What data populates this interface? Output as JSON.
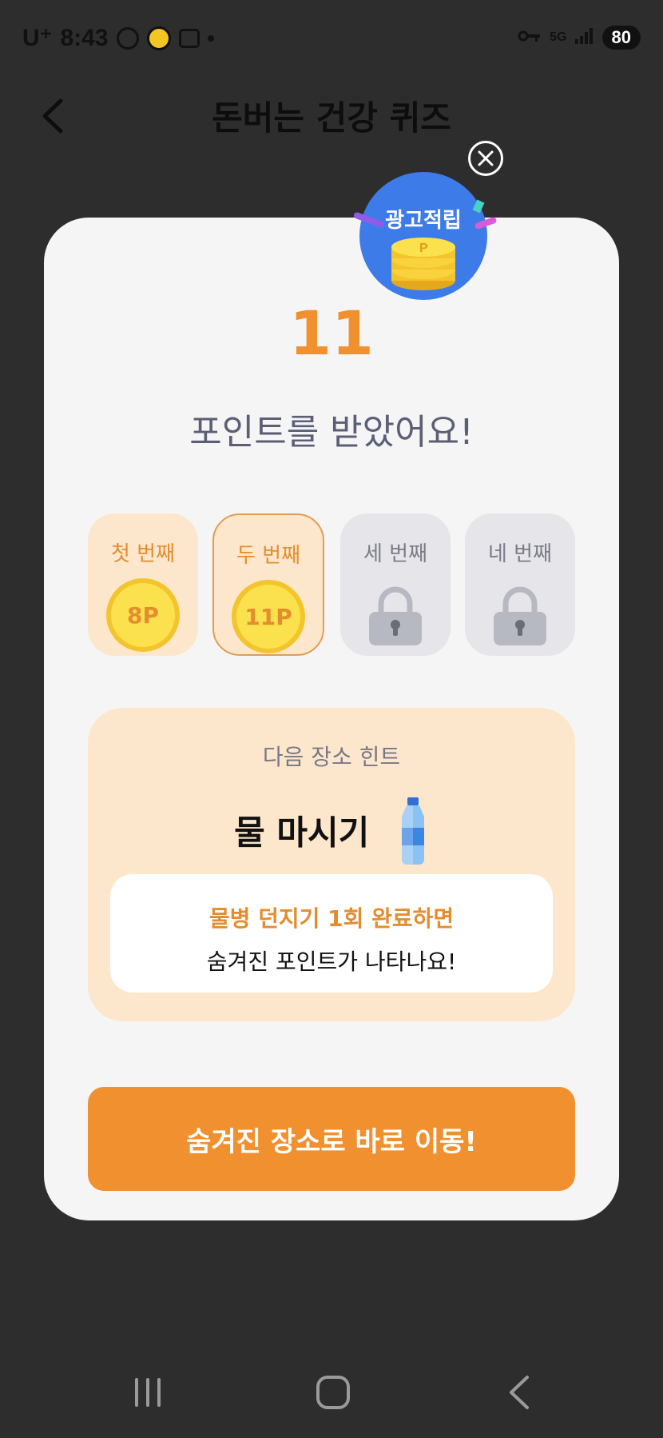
{
  "status_bar": {
    "carrier": "U⁺",
    "time": "8:43",
    "network": "5G",
    "battery": "80"
  },
  "header": {
    "title": "돈버는 건강 퀴즈"
  },
  "reward": {
    "badge_label": "광고적립",
    "points": "11",
    "message": "포인트를 받았어요!"
  },
  "steps": [
    {
      "label": "첫 번째",
      "value": "8P",
      "state": "done"
    },
    {
      "label": "두 번째",
      "value": "11P",
      "state": "active"
    },
    {
      "label": "세 번째",
      "state": "locked"
    },
    {
      "label": "네 번째",
      "state": "locked"
    }
  ],
  "hint": {
    "subtitle": "다음 장소 힌트",
    "title": "물 마시기",
    "line1": "물병 던지기 1회 완료하면",
    "line2": "숨겨진 포인트가 나타나요!"
  },
  "cta": {
    "label": "숨겨진 장소로 바로 이동!"
  },
  "colors": {
    "accent": "#f0902f",
    "card_bg": "#f5f5f5",
    "hint_bg": "#fde7cc",
    "badge_blue": "#3d7be8"
  }
}
